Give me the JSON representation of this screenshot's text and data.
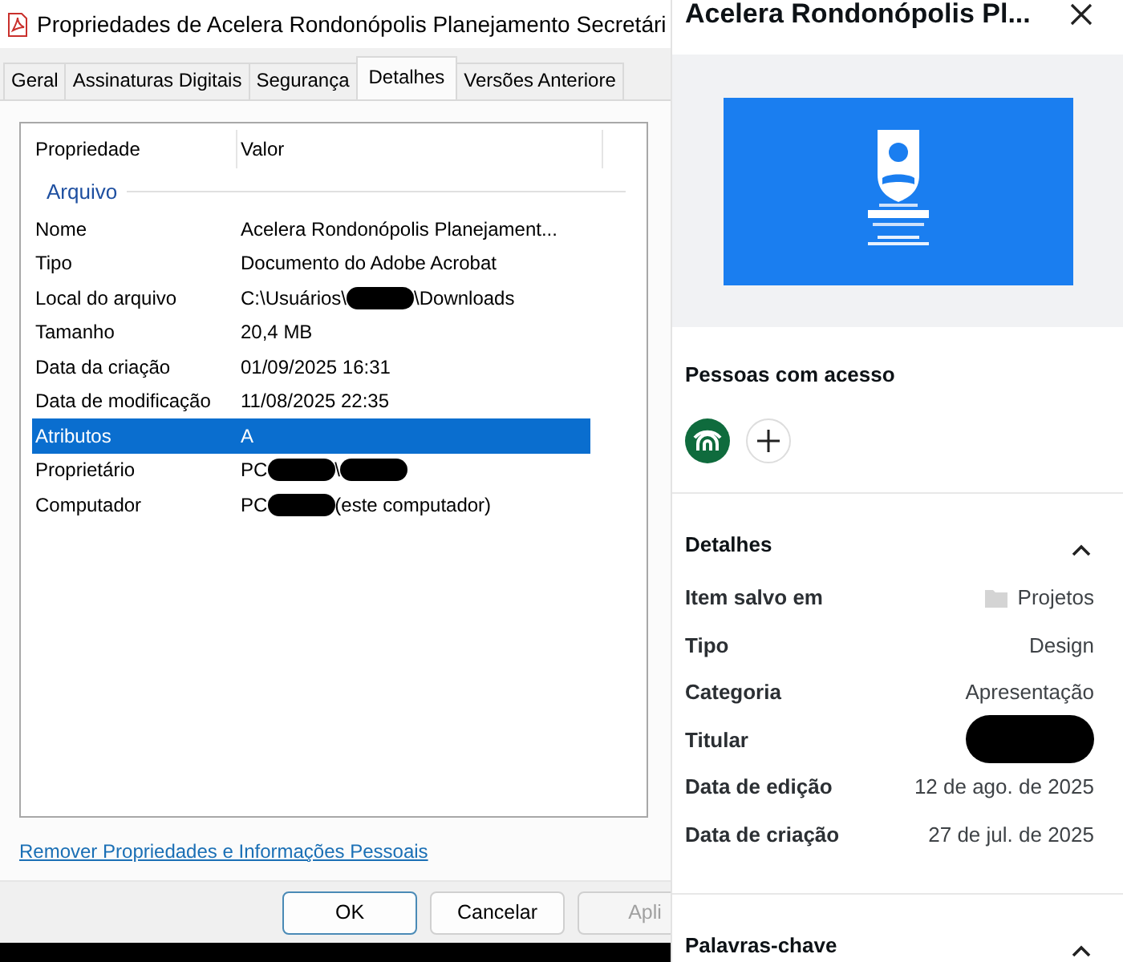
{
  "dialog": {
    "title": "Propriedades de Acelera Rondonópolis Planejamento Secretári",
    "tabs": [
      {
        "label": "Geral",
        "selected": false
      },
      {
        "label": "Assinaturas Digitais",
        "selected": false
      },
      {
        "label": "Segurança",
        "selected": false
      },
      {
        "label": "Detalhes",
        "selected": true
      },
      {
        "label": "Versões Anteriore",
        "selected": false
      }
    ],
    "table": {
      "columns": [
        "Propriedade",
        "Valor"
      ],
      "group": "Arquivo",
      "rows": [
        {
          "property": "Nome",
          "value": [
            {
              "kind": "text",
              "text": "Acelera Rondonópolis Planejament..."
            }
          ],
          "selected": false
        },
        {
          "property": "Tipo",
          "value": [
            {
              "kind": "text",
              "text": "Documento do Adobe Acrobat"
            }
          ],
          "selected": false
        },
        {
          "property": "Local do arquivo",
          "value": [
            {
              "kind": "text",
              "text": "C:\\Usuários\\"
            },
            {
              "kind": "redaction"
            },
            {
              "kind": "text",
              "text": "\\Downloads"
            }
          ],
          "selected": false
        },
        {
          "property": "Tamanho",
          "value": [
            {
              "kind": "text",
              "text": "20,4 MB"
            }
          ],
          "selected": false
        },
        {
          "property": "Data da criação",
          "value": [
            {
              "kind": "text",
              "text": "01/09/2025 16:31"
            }
          ],
          "selected": false
        },
        {
          "property": "Data de modificação",
          "value": [
            {
              "kind": "text",
              "text": "11/08/2025 22:35"
            }
          ],
          "selected": false
        },
        {
          "property": "Atributos",
          "value": [
            {
              "kind": "text",
              "text": "A"
            }
          ],
          "selected": true
        },
        {
          "property": "Proprietário",
          "value": [
            {
              "kind": "text",
              "text": "PC"
            },
            {
              "kind": "redaction"
            },
            {
              "kind": "text",
              "text": "\\"
            },
            {
              "kind": "redaction"
            }
          ],
          "selected": false
        },
        {
          "property": "Computador",
          "value": [
            {
              "kind": "text",
              "text": "PC"
            },
            {
              "kind": "redaction"
            },
            {
              "kind": "text",
              "text": "(este computador)"
            }
          ],
          "selected": false
        }
      ]
    },
    "link": "Remover Propriedades e Informações Pessoais",
    "buttons": [
      {
        "label": "OK",
        "default": true,
        "disabled": false
      },
      {
        "label": "Cancelar",
        "default": false,
        "disabled": false
      },
      {
        "label": "Apli",
        "default": false,
        "disabled": true
      }
    ]
  },
  "panel": {
    "title": "Acelera Rondonópolis Pl...",
    "people": {
      "heading": "Pessoas com acesso"
    },
    "sections": [
      {
        "heading": "Detalhes",
        "expanded": true,
        "rows": [
          {
            "label": "Item salvo em",
            "value": [
              {
                "kind": "folder"
              },
              {
                "kind": "text",
                "text": "Projetos"
              }
            ]
          },
          {
            "label": "Tipo",
            "value": [
              {
                "kind": "text",
                "text": "Design"
              }
            ]
          },
          {
            "label": "Categoria",
            "value": [
              {
                "kind": "text",
                "text": "Apresentação"
              }
            ]
          },
          {
            "label": "Titular",
            "value": [
              {
                "kind": "redaction"
              }
            ]
          },
          {
            "label": "Data de edição",
            "value": [
              {
                "kind": "text",
                "text": "12 de ago. de 2025"
              }
            ]
          },
          {
            "label": "Data de criação",
            "value": [
              {
                "kind": "text",
                "text": "27 de jul. de 2025"
              }
            ]
          }
        ]
      },
      {
        "heading": "Palavras-chave",
        "expanded": true
      }
    ]
  }
}
